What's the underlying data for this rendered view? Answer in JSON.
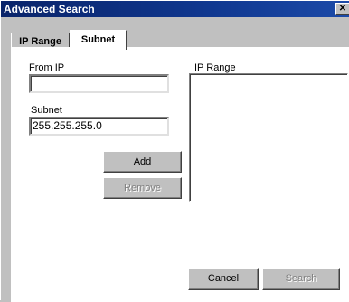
{
  "window": {
    "title": "Advanced Search",
    "close_glyph": "✕"
  },
  "tabs": [
    {
      "label": "IP Range",
      "active": false
    },
    {
      "label": "Subnet",
      "active": true
    }
  ],
  "form": {
    "from_ip_label": "From IP",
    "from_ip_value": "",
    "subnet_label": "Subnet",
    "subnet_value": "255.255.255.0",
    "ip_range_label": "IP Range"
  },
  "buttons": {
    "add": "Add",
    "remove": "Remove",
    "cancel": "Cancel",
    "search": "Search"
  }
}
